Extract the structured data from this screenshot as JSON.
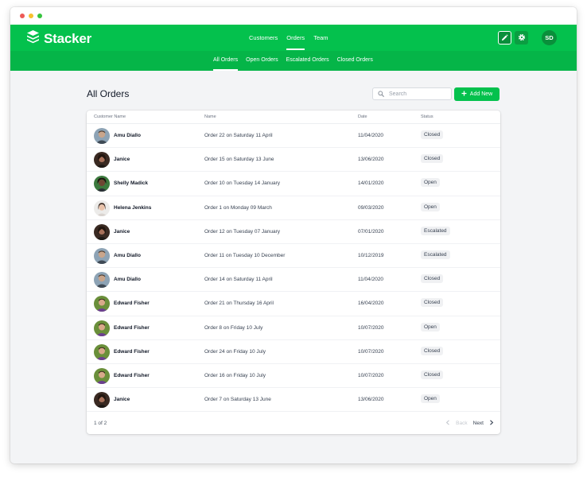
{
  "app": {
    "name": "Stacker",
    "user_initials": "SD"
  },
  "nav": {
    "main": [
      {
        "label": "Customers"
      },
      {
        "label": "Orders"
      },
      {
        "label": "Team"
      }
    ],
    "sub": [
      {
        "label": "All Orders"
      },
      {
        "label": "Open Orders"
      },
      {
        "label": "Escalated Orders"
      },
      {
        "label": "Closed Orders"
      }
    ]
  },
  "page": {
    "title": "All Orders",
    "search_placeholder": "Search",
    "add_label": "Add New"
  },
  "table": {
    "columns": {
      "customer": "Customer Name",
      "name": "Name",
      "date": "Date",
      "status": "Status"
    },
    "rows": [
      {
        "customer": "Amu Diallo",
        "name": "Order 22 on Saturday 11 April",
        "date": "11/04/2020",
        "status": "Closed"
      },
      {
        "customer": "Janice",
        "name": "Order 15 on Saturday 13 June",
        "date": "13/06/2020",
        "status": "Closed"
      },
      {
        "customer": "Shelly Madick",
        "name": "Order 10 on Tuesday 14 January",
        "date": "14/01/2020",
        "status": "Open"
      },
      {
        "customer": "Helena Jenkins",
        "name": "Order 1 on Monday 09 March",
        "date": "09/03/2020",
        "status": "Open"
      },
      {
        "customer": "Janice",
        "name": "Order 12 on Tuesday 07 January",
        "date": "07/01/2020",
        "status": "Escalated"
      },
      {
        "customer": "Amu Diallo",
        "name": "Order 11 on Tuesday 10 December",
        "date": "10/12/2019",
        "status": "Escalated"
      },
      {
        "customer": "Amu Diallo",
        "name": "Order 14 on Saturday 11 April",
        "date": "11/04/2020",
        "status": "Closed"
      },
      {
        "customer": "Edward Fisher",
        "name": "Order 21 on Thursday 16 April",
        "date": "16/04/2020",
        "status": "Closed"
      },
      {
        "customer": "Edward Fisher",
        "name": "Order 8 on Friday 10 July",
        "date": "10/07/2020",
        "status": "Open"
      },
      {
        "customer": "Edward Fisher",
        "name": "Order 24 on Friday 10 July",
        "date": "10/07/2020",
        "status": "Closed"
      },
      {
        "customer": "Edward Fisher",
        "name": "Order 16 on Friday 10 July",
        "date": "10/07/2020",
        "status": "Closed"
      },
      {
        "customer": "Janice",
        "name": "Order 7 on Saturday 13 June",
        "date": "13/06/2020",
        "status": "Open"
      }
    ]
  },
  "pagination": {
    "count": "1 of 2",
    "back": "Back",
    "next": "Next"
  },
  "colors": {
    "brand": "#04c14d",
    "brand_dark": "#05b548"
  }
}
